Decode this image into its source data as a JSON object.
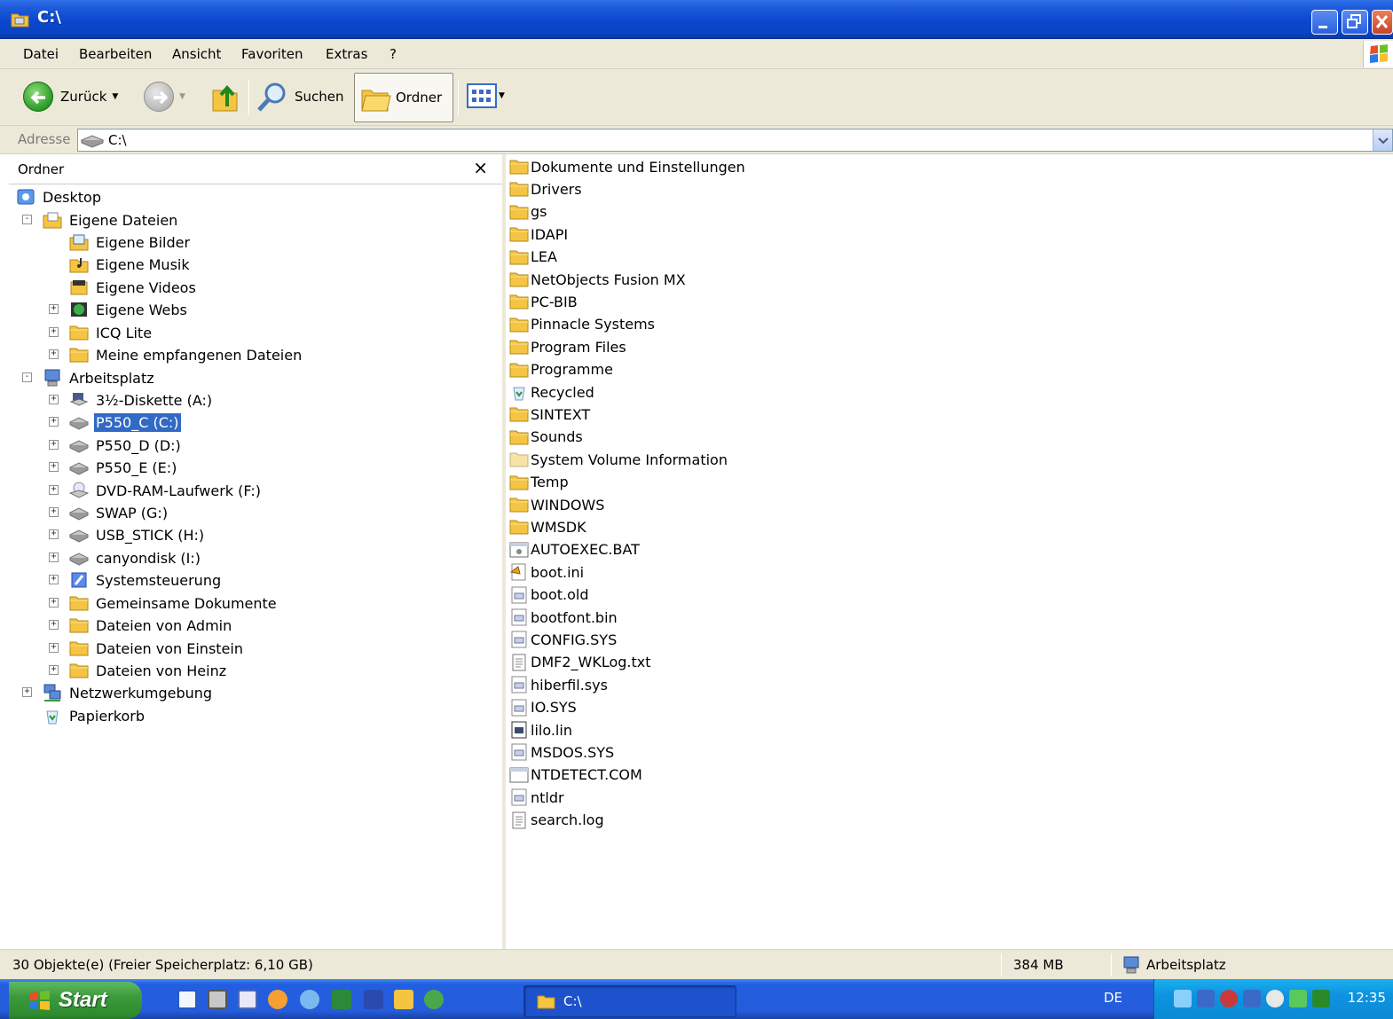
{
  "window": {
    "title": "C:\\"
  },
  "menu": {
    "items": [
      "Datei",
      "Bearbeiten",
      "Ansicht",
      "Favoriten",
      "Extras",
      "?"
    ]
  },
  "toolbar": {
    "back_label": "Zurück",
    "search_label": "Suchen",
    "folders_label": "Ordner"
  },
  "address": {
    "label": "Adresse",
    "value": "C:\\"
  },
  "folder_pane": {
    "title": "Ordner",
    "close_glyph": "×",
    "tree": [
      {
        "label": "Desktop",
        "icon": "desktop-icon"
      },
      {
        "label": "Eigene Dateien",
        "icon": "my-documents-icon"
      },
      {
        "label": "Eigene Bilder",
        "icon": "my-pictures-icon"
      },
      {
        "label": "Eigene Musik",
        "icon": "my-music-icon"
      },
      {
        "label": "Eigene Videos",
        "icon": "my-videos-icon"
      },
      {
        "label": "Eigene Webs",
        "icon": "my-webs-icon"
      },
      {
        "label": "ICQ Lite",
        "icon": "folder-icon"
      },
      {
        "label": "Meine empfangenen Dateien",
        "icon": "folder-icon"
      },
      {
        "label": "Arbeitsplatz",
        "icon": "my-computer-icon"
      },
      {
        "label": "3½-Diskette (A:)",
        "icon": "floppy-drive-icon"
      },
      {
        "label": "P550_C (C:)",
        "icon": "hard-drive-icon",
        "selected": true
      },
      {
        "label": "P550_D (D:)",
        "icon": "hard-drive-icon"
      },
      {
        "label": "P550_E (E:)",
        "icon": "hard-drive-icon"
      },
      {
        "label": "DVD-RAM-Laufwerk (F:)",
        "icon": "dvd-drive-icon"
      },
      {
        "label": "SWAP (G:)",
        "icon": "hard-drive-icon"
      },
      {
        "label": "USB_STICK (H:)",
        "icon": "hard-drive-icon"
      },
      {
        "label": "canyondisk (I:)",
        "icon": "hard-drive-icon"
      },
      {
        "label": "Systemsteuerung",
        "icon": "control-panel-icon"
      },
      {
        "label": "Gemeinsame Dokumente",
        "icon": "folder-icon"
      },
      {
        "label": "Dateien von Admin",
        "icon": "folder-icon"
      },
      {
        "label": "Dateien von Einstein",
        "icon": "folder-icon"
      },
      {
        "label": "Dateien von Heinz",
        "icon": "folder-icon"
      },
      {
        "label": "Netzwerkumgebung",
        "icon": "network-icon"
      },
      {
        "label": "Papierkorb",
        "icon": "recycle-bin-icon"
      }
    ]
  },
  "files": [
    {
      "name": "Dokumente und Einstellungen",
      "icon": "folder-icon"
    },
    {
      "name": "Drivers",
      "icon": "folder-icon"
    },
    {
      "name": "gs",
      "icon": "folder-icon"
    },
    {
      "name": "IDAPI",
      "icon": "folder-icon"
    },
    {
      "name": "LEA",
      "icon": "folder-icon"
    },
    {
      "name": "NetObjects Fusion MX",
      "icon": "folder-icon"
    },
    {
      "name": "PC-BIB",
      "icon": "folder-icon"
    },
    {
      "name": "Pinnacle Systems",
      "icon": "folder-icon"
    },
    {
      "name": "Program Files",
      "icon": "folder-icon"
    },
    {
      "name": "Programme",
      "icon": "folder-icon"
    },
    {
      "name": "Recycled",
      "icon": "recycle-bin-icon"
    },
    {
      "name": "SINTEXT",
      "icon": "folder-icon"
    },
    {
      "name": "Sounds",
      "icon": "folder-icon"
    },
    {
      "name": "System Volume Information",
      "icon": "folder-light-icon"
    },
    {
      "name": "Temp",
      "icon": "folder-icon"
    },
    {
      "name": "WINDOWS",
      "icon": "folder-icon"
    },
    {
      "name": "WMSDK",
      "icon": "folder-icon"
    },
    {
      "name": "AUTOEXEC.BAT",
      "icon": "batch-file-icon"
    },
    {
      "name": "boot.ini",
      "icon": "settings-file-icon"
    },
    {
      "name": "boot.old",
      "icon": "system-file-icon"
    },
    {
      "name": "bootfont.bin",
      "icon": "system-file-icon"
    },
    {
      "name": "CONFIG.SYS",
      "icon": "system-file-icon"
    },
    {
      "name": "DMF2_WKLog.txt",
      "icon": "text-file-icon"
    },
    {
      "name": "hiberfil.sys",
      "icon": "system-file-icon"
    },
    {
      "name": "IO.SYS",
      "icon": "system-file-icon"
    },
    {
      "name": "lilo.lin",
      "icon": "system-file-dark-icon"
    },
    {
      "name": "MSDOS.SYS",
      "icon": "system-file-icon"
    },
    {
      "name": "NTDETECT.COM",
      "icon": "application-icon"
    },
    {
      "name": "ntldr",
      "icon": "system-file-icon"
    },
    {
      "name": "search.log",
      "icon": "text-file-icon"
    }
  ],
  "status": {
    "objects": "30 Objekte(e) (Freier Speicherplatz: 6,10 GB)",
    "size": "384 MB",
    "location": "Arbeitsplatz"
  },
  "taskbar": {
    "start_label": "Start",
    "window_label": "C:\\",
    "language": "DE",
    "clock": "12:35"
  },
  "colors": {
    "titlebar": "#0a47cf",
    "selection": "#316ac5",
    "folder": "#f5c443",
    "start_green": "#3c9a3c"
  }
}
